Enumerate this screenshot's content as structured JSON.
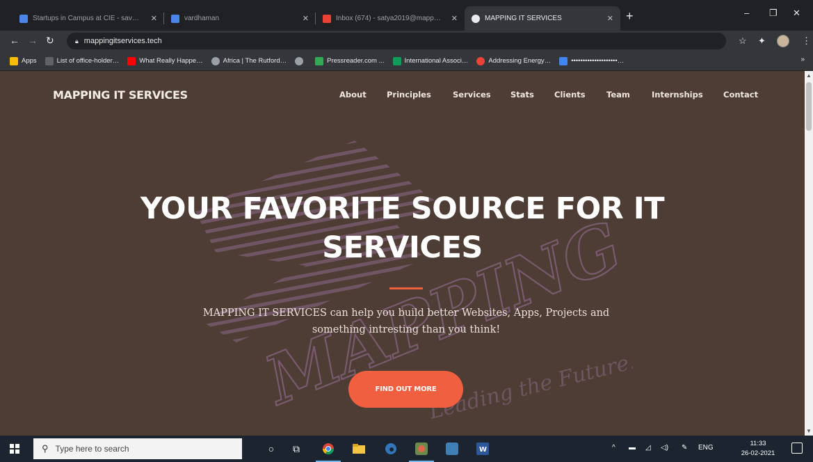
{
  "browser": {
    "tabs": [
      {
        "title": "Startups in Campus at CIE - sav…",
        "favicon_color": "#4a86e8",
        "active": false
      },
      {
        "title": "vardhaman",
        "favicon_color": "#4a86e8",
        "active": false
      },
      {
        "title": "Inbox (674) - satya2019@mapp…",
        "favicon_color": "#ea4335",
        "active": false
      },
      {
        "title": "MAPPING IT SERVICES",
        "favicon_color": "#e8eaed",
        "active": true
      }
    ],
    "url": "mappingitservices.tech",
    "bookmarks": [
      {
        "label": "Apps",
        "color": "#fbbc05"
      },
      {
        "label": "List of office-holder…",
        "color": "#5f6368"
      },
      {
        "label": "What Really Happe…",
        "color": "#ff0000"
      },
      {
        "label": "Africa | The Rutford…",
        "color": "#9aa0a6"
      },
      {
        "label": "",
        "color": "#9aa0a6"
      },
      {
        "label": "Pressreader.com ...",
        "color": "#34a853"
      },
      {
        "label": "International Associ…",
        "color": "#0f9d58"
      },
      {
        "label": "Addressing Energy…",
        "color": "#ea4335"
      },
      {
        "label": "••••••••••••••••••••…",
        "color": "#4285f4"
      }
    ]
  },
  "site": {
    "brand": "MAPPING IT SERVICES",
    "nav": [
      "About",
      "Principles",
      "Services",
      "Stats",
      "Clients",
      "Team",
      "Internships",
      "Contact"
    ],
    "hero_title_line1": "YOUR FAVORITE SOURCE FOR IT",
    "hero_title_line2": "SERVICES",
    "hero_sub_line1": "MAPPING IT SERVICES can help you build better Websites, Apps, Projects and",
    "hero_sub_line2": "something intresting than you think!",
    "cta": "FIND OUT MORE",
    "watermark_word": "MAPPING",
    "watermark_tagline": "Leading the Future...",
    "colors": {
      "background": "#4e3d35",
      "accent": "#f05f40",
      "watermark": "#7a5a6e"
    }
  },
  "taskbar": {
    "search_placeholder": "Type here to search",
    "language": "ENG",
    "time": "11:33",
    "date": "26-02-2021"
  }
}
